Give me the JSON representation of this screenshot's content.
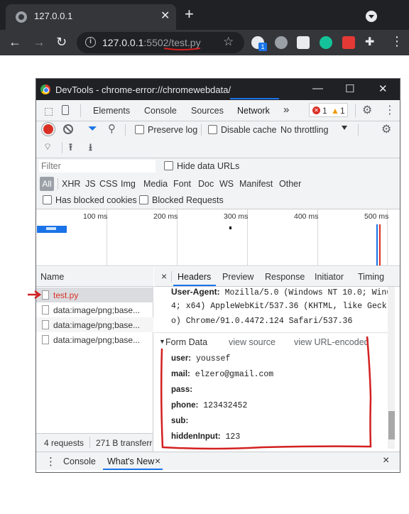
{
  "browser": {
    "tab_title": "127.0.0.1",
    "tab_close": "✕",
    "new_tab": "+",
    "url_host": "127.0.0.1",
    "url_port": ":5502/",
    "url_path": "test.py",
    "ext_badge": "1"
  },
  "devtools": {
    "window_title": "DevTools - chrome-error://chromewebdata/",
    "tabs": [
      "Elements",
      "Console",
      "Sources",
      "Network"
    ],
    "more_tabs": "»",
    "error_count": "1",
    "warning_count": "1",
    "controls": {
      "preserve_log": "Preserve log",
      "disable_cache": "Disable cache",
      "throttling": "No throttling"
    },
    "filter": {
      "placeholder": "Filter",
      "hide_data_urls": "Hide data URLs",
      "types": [
        "All",
        "XHR",
        "JS",
        "CSS",
        "Img",
        "Media",
        "Font",
        "Doc",
        "WS",
        "Manifest",
        "Other"
      ],
      "has_blocked_cookies": "Has blocked cookies",
      "blocked_requests": "Blocked Requests"
    },
    "timeline_ticks": [
      "100 ms",
      "200 ms",
      "300 ms",
      "400 ms",
      "500 ms"
    ],
    "requests": {
      "header": "Name",
      "items": [
        "test.py",
        "data:image/png;base...",
        "data:image/png;base...",
        "data:image/png;base..."
      ],
      "count": "4 requests",
      "transferred": "271 B transferr"
    },
    "detail_tabs": [
      "Headers",
      "Preview",
      "Response",
      "Initiator",
      "Timing"
    ],
    "detail_close": "×",
    "headers": {
      "key": "User-Agent:",
      "lines": [
        "Mozilla/5.0 (Windows NT 10.0; Win6",
        "4; x64) AppleWebKit/537.36 (KHTML, like Geck",
        "o) Chrome/91.0.4472.124 Safari/537.36"
      ]
    },
    "form_data": {
      "title": "Form Data",
      "view_source": "view source",
      "view_url_encoded": "view URL-encoded",
      "fields": [
        {
          "key": "user:",
          "value": "youssef"
        },
        {
          "key": "mail:",
          "value": "elzero@gmail.com"
        },
        {
          "key": "pass:",
          "value": ""
        },
        {
          "key": "phone:",
          "value": "123432452"
        },
        {
          "key": "sub:",
          "value": ""
        },
        {
          "key": "hiddenInput:",
          "value": "123"
        }
      ]
    },
    "drawer": {
      "console": "Console",
      "whats_new": "What's New",
      "close": "×"
    }
  },
  "colors": {
    "annotation_red": "#d32020",
    "accent_blue": "#1a73e8"
  }
}
